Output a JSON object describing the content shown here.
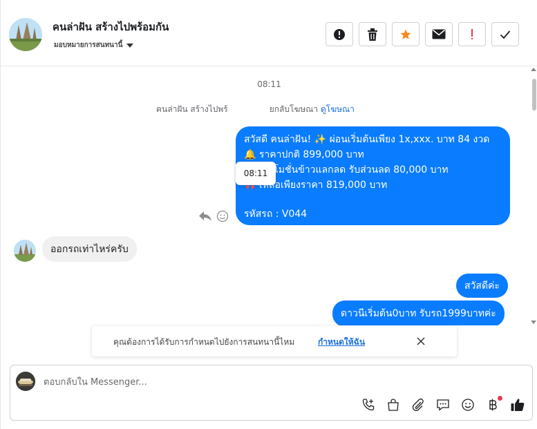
{
  "header": {
    "title": "คนล่าฝัน สร้างไปพร้อมกัน",
    "assign_label": "มอบหมายการสนทนานี้",
    "toolbar": [
      {
        "name": "spam-info",
        "icon": "info-circle-icon"
      },
      {
        "name": "delete",
        "icon": "trash-icon"
      },
      {
        "name": "star",
        "icon": "star-icon"
      },
      {
        "name": "mark-unread",
        "icon": "envelope-icon"
      },
      {
        "name": "flag",
        "icon": "exclamation-icon"
      },
      {
        "name": "done",
        "icon": "check-icon"
      }
    ],
    "star_color": "#f28b1d",
    "flag_color": "#e8384f"
  },
  "thread": {
    "timestamp": "08:11",
    "system_message_prefix": "คนล่าฝัน สร้างไปพร้",
    "system_message_suffix": "ยกลับโฆษณา",
    "system_message_link": "ดูโฆษณา",
    "tooltip_time": "08:11",
    "outgoing_big": [
      "สวัสดี คนล่าฝัน! ✨  ผ่อนเริ่มต้นเพียง 1x,xxx. บาท 84 งวด",
      "🔔 ราคาปกติ 899,000 บาท",
      "** โปรโมชั่นข้าวแลกลด รับส่วนลด 80,000 บาท",
      "🎀  เหลือเพียงราคา 819,000 บาท",
      "",
      "รหัสรถ : V044"
    ],
    "incoming": "ออกรถเท่าไหร่ครับ",
    "outgoing_2": "สวัสดีค่ะ",
    "outgoing_3": "ดาวนีเริ่มต้น0บาท รับรถ1999บาทค่ะ",
    "bubble_color": "#0a7cff"
  },
  "prompt": {
    "text": "คุณต้องการได้รับการกำหนดไปยังการสนทนานี้ไหม",
    "link": "กำหนดให้ฉัน"
  },
  "composer": {
    "placeholder": "ตอบกลับใน Messenger...",
    "tools": [
      "phone-plus-icon",
      "shopping-bag-icon",
      "paperclip-icon",
      "chat-bubble-icon",
      "smiley-icon",
      "baht-icon",
      "thumbs-up-icon"
    ]
  }
}
